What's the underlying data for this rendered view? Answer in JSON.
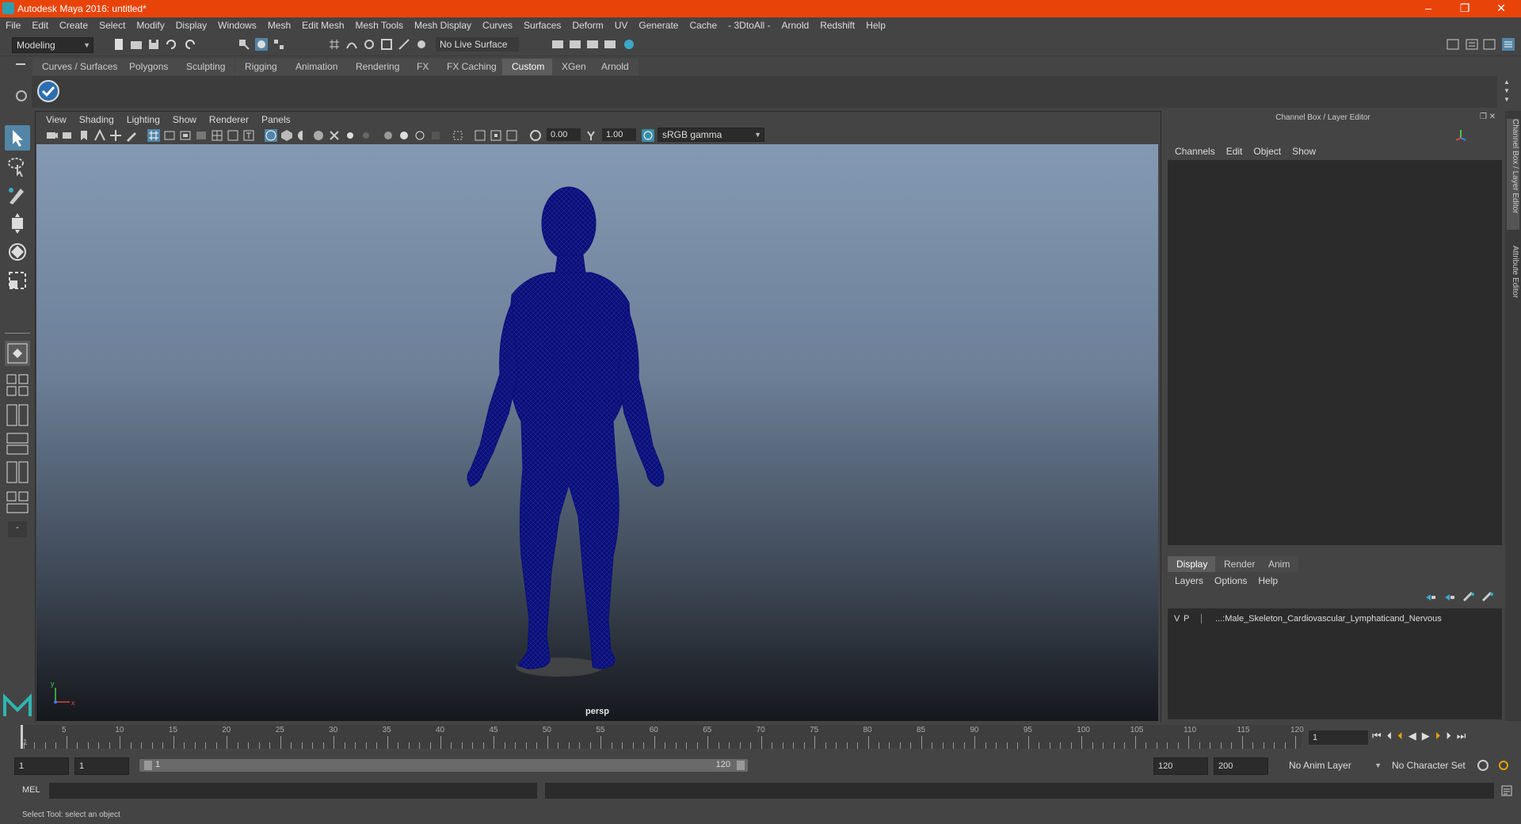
{
  "window": {
    "title": "Autodesk Maya 2016: untitled*",
    "controls": [
      "–",
      "❐",
      "✕"
    ]
  },
  "menubar": [
    "File",
    "Edit",
    "Create",
    "Select",
    "Modify",
    "Display",
    "Windows",
    "Mesh",
    "Edit Mesh",
    "Mesh Tools",
    "Mesh Display",
    "Curves",
    "Surfaces",
    "Deform",
    "UV",
    "Generate",
    "Cache",
    "- 3DtoAll -",
    "Arnold",
    "Redshift",
    "Help"
  ],
  "statusline": {
    "mode": "Modeling",
    "live_surface": "No Live Surface"
  },
  "shelf_tabs": [
    "Curves / Surfaces",
    "Polygons",
    "Sculpting",
    "Rigging",
    "Animation",
    "Rendering",
    "FX",
    "FX Caching",
    "Custom",
    "XGen",
    "Arnold"
  ],
  "active_shelf_tab": "Custom",
  "viewport": {
    "menu": [
      "View",
      "Shading",
      "Lighting",
      "Show",
      "Renderer",
      "Panels"
    ],
    "exposure": "0.00",
    "gamma": "1.00",
    "color_space": "sRGB gamma",
    "camera_label": "persp",
    "axis_x": "x",
    "axis_y": "y"
  },
  "channel_box": {
    "title": "Channel Box / Layer Editor",
    "menu": [
      "Channels",
      "Edit",
      "Object",
      "Show"
    ]
  },
  "layer_editor": {
    "tabs": [
      "Display",
      "Render",
      "Anim"
    ],
    "active_tab": "Display",
    "menu": [
      "Layers",
      "Options",
      "Help"
    ],
    "layers": [
      {
        "v": "V",
        "p": "P",
        "name": "...:Male_Skeleton_Cardiovascular_Lymphaticand_Nervous"
      }
    ]
  },
  "side_tabs": [
    "Channel Box / Layer Editor",
    "Attribute Editor"
  ],
  "timeslider": {
    "ticks": [
      "1",
      "5",
      "10",
      "15",
      "20",
      "25",
      "30",
      "35",
      "40",
      "45",
      "50",
      "55",
      "60",
      "65",
      "70",
      "75",
      "80",
      "85",
      "90",
      "95",
      "100",
      "105",
      "110",
      "115",
      "120"
    ],
    "current_frame": "1"
  },
  "range": {
    "start": "1",
    "playback_start": "1",
    "slider_start": "1",
    "slider_end": "120",
    "playback_end": "120",
    "end": "200",
    "anim_layer": "No Anim Layer",
    "character_set": "No Character Set"
  },
  "cmdline": {
    "label": "MEL"
  },
  "help_line": "Select Tool: select an object",
  "colors": {
    "titlebar": "#e8440a",
    "model": "#0a0f7a",
    "selected_tool": "#5285a6"
  }
}
